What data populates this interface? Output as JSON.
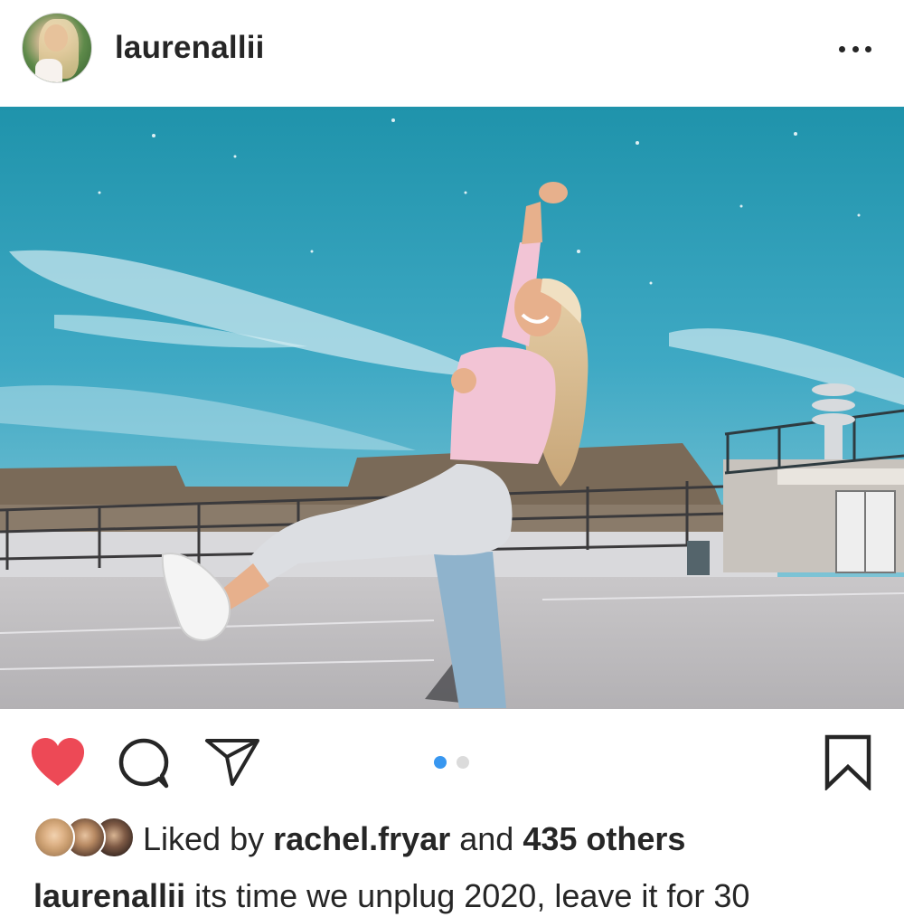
{
  "post": {
    "username": "laurenallii",
    "avatar_icon": "profile-photo",
    "more_icon": "more-horizontal-icon"
  },
  "actions": {
    "like_icon": "heart-filled-icon",
    "like_color": "#ED4956",
    "comment_icon": "comment-bubble-icon",
    "share_icon": "paper-plane-icon",
    "save_icon": "bookmark-icon",
    "carousel": {
      "count": 2,
      "active_index": 0,
      "active_color": "#3897F0",
      "inactive_color": "#DBDBDB"
    }
  },
  "likes": {
    "prefix": "Liked by",
    "user": "rachel.fryar",
    "joiner": "and",
    "others": "435 others"
  },
  "caption": {
    "username": "laurenallii",
    "text": "its time we unplug 2020, leave it for 30"
  },
  "colors": {
    "text": "#262626",
    "sky": "#2E9DB4",
    "background": "#FFFFFF"
  }
}
